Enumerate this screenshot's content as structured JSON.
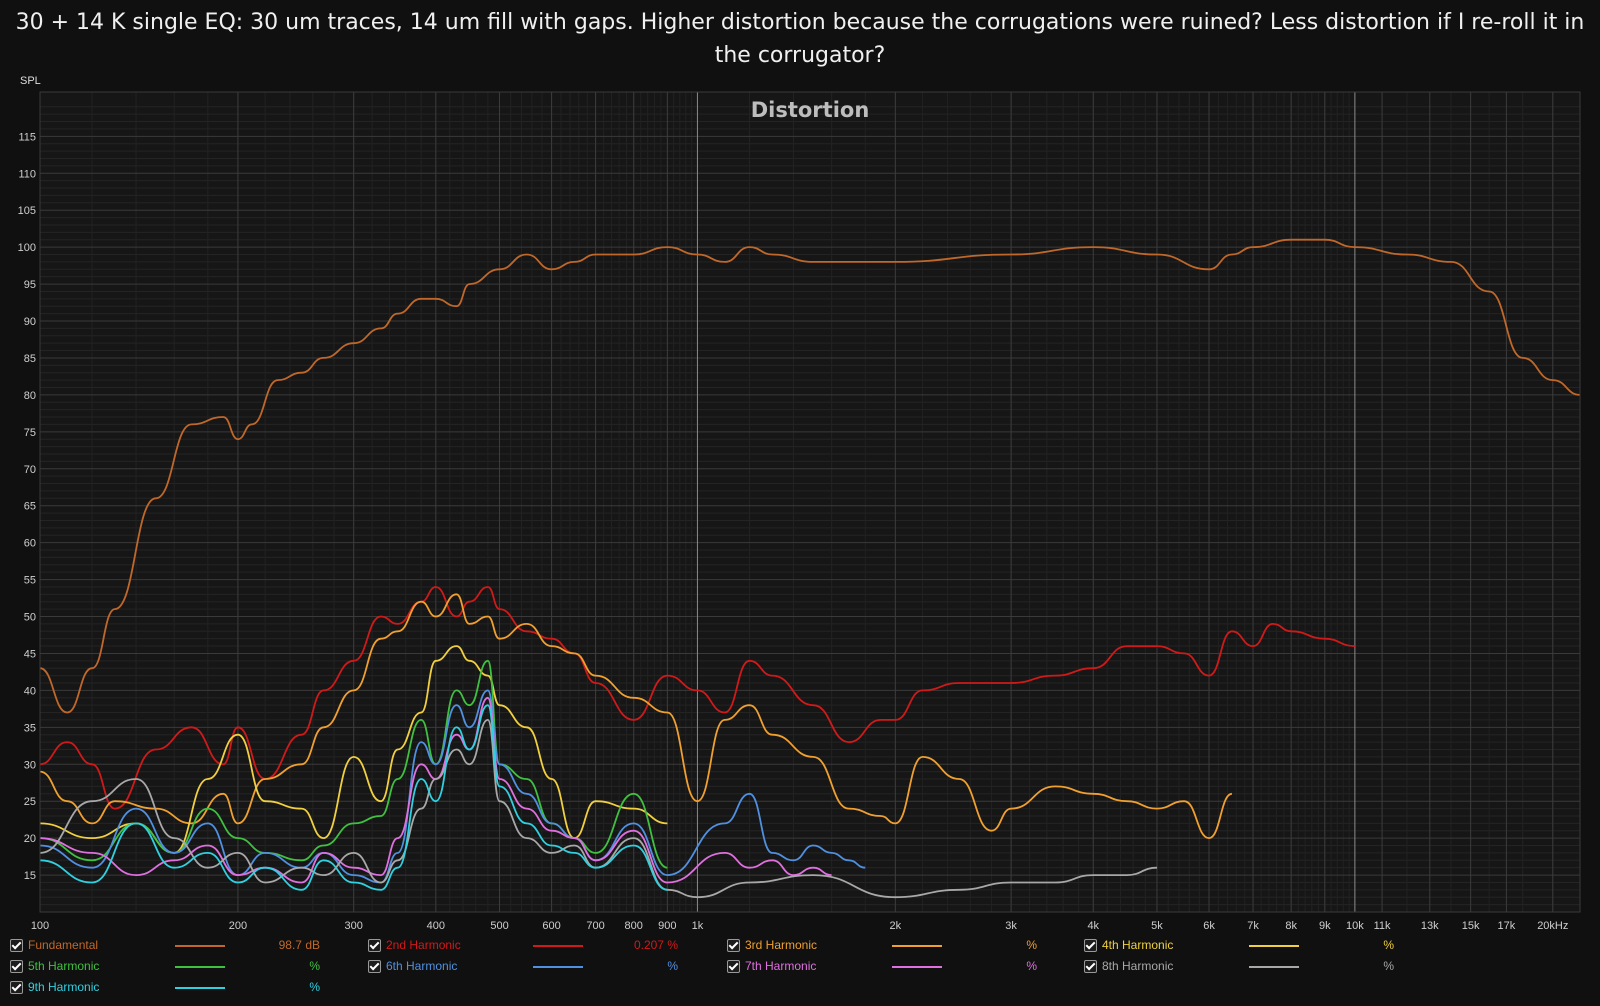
{
  "title": "30 + 14 K single EQ: 30 um traces, 14 um fill with gaps. Higher distortion because the corrugations were ruined? Less distortion if I re-roll it in the corrugator?",
  "chart_data": {
    "type": "line",
    "title": "Distortion",
    "ylabel": "SPL",
    "xscale": "log",
    "xlim": [
      100,
      22000
    ],
    "ylim": [
      10,
      121
    ],
    "y_ticks": [
      15,
      20,
      25,
      30,
      35,
      40,
      45,
      50,
      55,
      60,
      65,
      70,
      75,
      80,
      85,
      90,
      95,
      100,
      105,
      110,
      115
    ],
    "x_ticks": [
      {
        "v": 100,
        "label": "100"
      },
      {
        "v": 200,
        "label": "200"
      },
      {
        "v": 300,
        "label": "300"
      },
      {
        "v": 400,
        "label": "400"
      },
      {
        "v": 500,
        "label": "500"
      },
      {
        "v": 600,
        "label": "600"
      },
      {
        "v": 700,
        "label": "700"
      },
      {
        "v": 800,
        "label": "800"
      },
      {
        "v": 900,
        "label": "900"
      },
      {
        "v": 1000,
        "label": "1k"
      },
      {
        "v": 2000,
        "label": "2k"
      },
      {
        "v": 3000,
        "label": "3k"
      },
      {
        "v": 4000,
        "label": "4k"
      },
      {
        "v": 5000,
        "label": "5k"
      },
      {
        "v": 6000,
        "label": "6k"
      },
      {
        "v": 7000,
        "label": "7k"
      },
      {
        "v": 8000,
        "label": "8k"
      },
      {
        "v": 9000,
        "label": "9k"
      },
      {
        "v": 10000,
        "label": "10k"
      },
      {
        "v": 11000,
        "label": "11k"
      },
      {
        "v": 13000,
        "label": "13k"
      },
      {
        "v": 15000,
        "label": "15k"
      },
      {
        "v": 17000,
        "label": "17k"
      },
      {
        "v": 20000,
        "label": "20kHz"
      }
    ],
    "grid": true,
    "legend_position": "bottom",
    "series": [
      {
        "name": "Fundamental",
        "color": "#c0682a",
        "value": "98.7 dB",
        "x": [
          100,
          110,
          120,
          130,
          150,
          170,
          190,
          200,
          210,
          230,
          250,
          270,
          300,
          330,
          350,
          380,
          400,
          430,
          450,
          500,
          550,
          600,
          650,
          700,
          800,
          900,
          1000,
          1100,
          1200,
          1300,
          1500,
          2000,
          3000,
          4000,
          5000,
          6000,
          6500,
          7000,
          8000,
          9000,
          10000,
          12000,
          14000,
          16000,
          18000,
          20000,
          22000
        ],
        "y": [
          43,
          37,
          43,
          51,
          66,
          76,
          77,
          74,
          76,
          82,
          83,
          85,
          87,
          89,
          91,
          93,
          93,
          92,
          95,
          97,
          99,
          97,
          98,
          99,
          99,
          100,
          99,
          98,
          100,
          99,
          98,
          98,
          99,
          100,
          99,
          97,
          99,
          100,
          101,
          101,
          100,
          99,
          98,
          94,
          85,
          82,
          80
        ]
      },
      {
        "name": "2nd Harmonic",
        "color": "#d01a1a",
        "value": "0.207 %",
        "x": [
          100,
          110,
          120,
          130,
          150,
          170,
          190,
          200,
          220,
          250,
          270,
          300,
          330,
          350,
          380,
          400,
          430,
          450,
          480,
          500,
          550,
          600,
          650,
          700,
          800,
          900,
          1000,
          1100,
          1200,
          1300,
          1500,
          1700,
          1900,
          2000,
          2200,
          2500,
          3000,
          3500,
          4000,
          4500,
          5000,
          5500,
          6000,
          6500,
          7000,
          7500,
          8000,
          9000,
          10000
        ],
        "y": [
          30,
          33,
          30,
          24,
          32,
          35,
          30,
          35,
          28,
          34,
          40,
          44,
          50,
          49,
          52,
          54,
          50,
          52,
          54,
          51,
          48,
          47,
          45,
          41,
          36,
          42,
          40,
          37,
          44,
          42,
          38,
          33,
          36,
          36,
          40,
          41,
          41,
          42,
          43,
          46,
          46,
          45,
          42,
          48,
          46,
          49,
          48,
          47,
          46
        ]
      },
      {
        "name": "3rd Harmonic",
        "color": "#f0a030",
        "value": "%",
        "x": [
          100,
          110,
          120,
          130,
          150,
          170,
          190,
          200,
          220,
          250,
          270,
          300,
          330,
          350,
          380,
          400,
          430,
          450,
          480,
          500,
          550,
          600,
          650,
          700,
          800,
          900,
          1000,
          1100,
          1200,
          1300,
          1500,
          1700,
          1900,
          2000,
          2200,
          2500,
          2800,
          3000,
          3500,
          4000,
          4500,
          5000,
          5500,
          6000,
          6500
        ],
        "y": [
          29,
          25,
          22,
          25,
          24,
          22,
          26,
          22,
          28,
          30,
          35,
          40,
          47,
          48,
          52,
          50,
          53,
          49,
          50,
          47,
          49,
          46,
          45,
          42,
          39,
          37,
          25,
          36,
          38,
          34,
          31,
          24,
          23,
          22,
          31,
          28,
          21,
          24,
          27,
          26,
          25,
          24,
          25,
          20,
          26
        ]
      },
      {
        "name": "4th Harmonic",
        "color": "#f0d040",
        "value": "%",
        "x": [
          100,
          120,
          140,
          160,
          180,
          200,
          220,
          250,
          270,
          300,
          330,
          350,
          380,
          400,
          430,
          450,
          480,
          500,
          550,
          600,
          650,
          700,
          800,
          900
        ],
        "y": [
          22,
          20,
          22,
          18,
          28,
          34,
          25,
          24,
          20,
          31,
          25,
          32,
          37,
          44,
          46,
          44,
          42,
          38,
          35,
          28,
          20,
          25,
          24,
          22
        ]
      },
      {
        "name": "5th Harmonic",
        "color": "#40c040",
        "value": "%",
        "x": [
          100,
          120,
          140,
          160,
          180,
          200,
          220,
          250,
          270,
          300,
          330,
          350,
          380,
          400,
          430,
          450,
          480,
          500,
          550,
          600,
          650,
          700,
          800,
          900
        ],
        "y": [
          20,
          17,
          22,
          18,
          24,
          20,
          18,
          17,
          19,
          22,
          23,
          28,
          36,
          30,
          40,
          38,
          44,
          30,
          28,
          22,
          20,
          18,
          26,
          16
        ]
      },
      {
        "name": "6th Harmonic",
        "color": "#5090e0",
        "value": "%",
        "x": [
          100,
          120,
          140,
          160,
          180,
          200,
          220,
          250,
          270,
          300,
          330,
          350,
          380,
          400,
          430,
          450,
          480,
          500,
          550,
          600,
          650,
          700,
          800,
          900,
          1100,
          1200,
          1300,
          1400,
          1500,
          1600,
          1700,
          1800
        ],
        "y": [
          19,
          16,
          24,
          18,
          22,
          15,
          18,
          16,
          18,
          15,
          14,
          18,
          33,
          30,
          38,
          35,
          40,
          30,
          26,
          22,
          20,
          17,
          22,
          15,
          22,
          26,
          18,
          17,
          19,
          18,
          17,
          16
        ]
      },
      {
        "name": "7th Harmonic",
        "color": "#e070e0",
        "value": "%",
        "x": [
          100,
          120,
          140,
          160,
          180,
          200,
          220,
          250,
          270,
          300,
          330,
          350,
          380,
          400,
          430,
          450,
          480,
          500,
          550,
          600,
          650,
          700,
          800,
          900,
          1100,
          1200,
          1300,
          1400,
          1500,
          1600
        ],
        "y": [
          20,
          18,
          15,
          17,
          19,
          15,
          16,
          14,
          18,
          16,
          15,
          20,
          30,
          28,
          34,
          32,
          39,
          28,
          24,
          21,
          20,
          17,
          21,
          14,
          18,
          16,
          17,
          15,
          16,
          15
        ]
      },
      {
        "name": "8th Harmonic",
        "color": "#a8a8a8",
        "value": "%",
        "x": [
          100,
          120,
          140,
          160,
          180,
          200,
          220,
          250,
          270,
          300,
          330,
          350,
          380,
          400,
          430,
          450,
          480,
          500,
          550,
          600,
          650,
          700,
          800,
          900,
          1000,
          1200,
          1500,
          2000,
          2500,
          3000,
          3500,
          4000,
          4500,
          5000
        ],
        "y": [
          18,
          25,
          28,
          20,
          16,
          18,
          14,
          16,
          15,
          18,
          14,
          17,
          24,
          28,
          32,
          30,
          36,
          25,
          20,
          18,
          19,
          16,
          20,
          13,
          12,
          14,
          15,
          12,
          13,
          14,
          14,
          15,
          15,
          16
        ]
      },
      {
        "name": "9th Harmonic",
        "color": "#30d0e0",
        "value": "%",
        "x": [
          100,
          120,
          140,
          160,
          180,
          200,
          220,
          250,
          270,
          300,
          330,
          350,
          380,
          400,
          430,
          450,
          480,
          500,
          550,
          600,
          650,
          700,
          800,
          900
        ],
        "y": [
          17,
          14,
          22,
          16,
          18,
          14,
          16,
          13,
          17,
          14,
          13,
          16,
          28,
          25,
          35,
          32,
          38,
          27,
          22,
          19,
          18,
          16,
          19,
          13
        ]
      }
    ]
  },
  "legend": [
    {
      "label": "Fundamental",
      "color": "#c0682a",
      "value": "98.7 dB"
    },
    {
      "label": "2nd Harmonic",
      "color": "#d01a1a",
      "value": "0.207 %"
    },
    {
      "label": "3rd Harmonic",
      "color": "#f0a030",
      "value": "%"
    },
    {
      "label": "4th Harmonic",
      "color": "#f0d040",
      "value": "%"
    },
    {
      "label": "5th Harmonic",
      "color": "#40c040",
      "value": "%"
    },
    {
      "label": "6th Harmonic",
      "color": "#5090e0",
      "value": "%"
    },
    {
      "label": "7th Harmonic",
      "color": "#e070e0",
      "value": "%"
    },
    {
      "label": "8th Harmonic",
      "color": "#a8a8a8",
      "value": "%"
    },
    {
      "label": "9th Harmonic",
      "color": "#30d0e0",
      "value": "%"
    }
  ]
}
